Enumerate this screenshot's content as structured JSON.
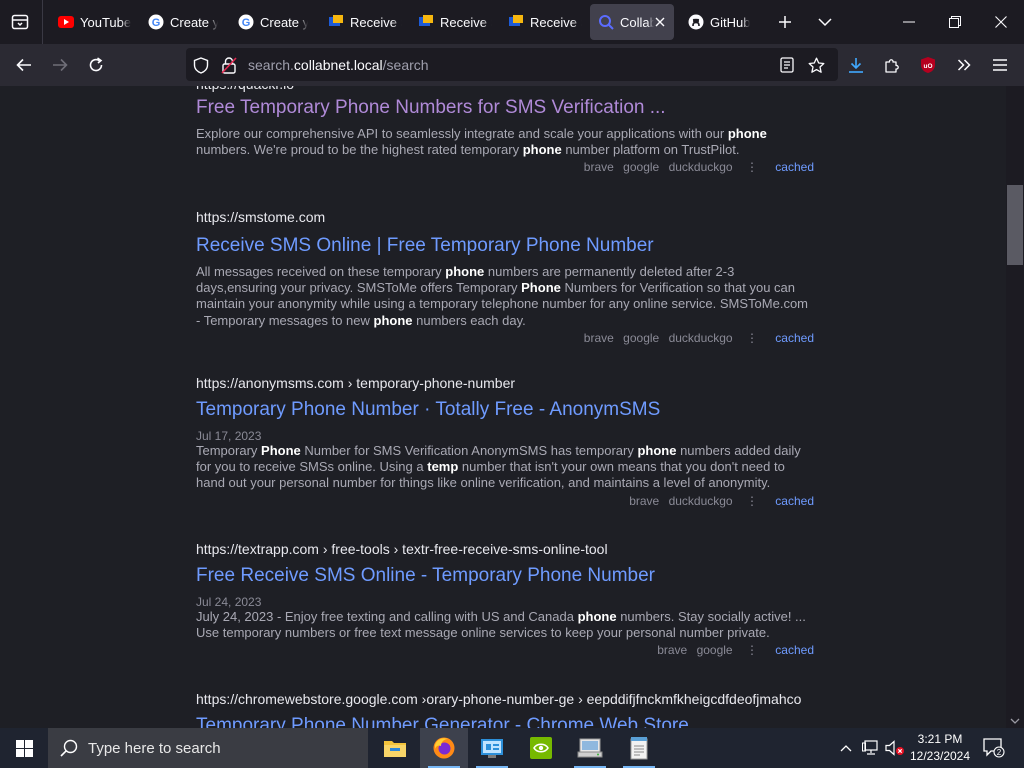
{
  "browser": {
    "tabs": [
      {
        "title": "YouTube",
        "favicon": "youtube-icon"
      },
      {
        "title": "Create yo",
        "favicon": "google-icon"
      },
      {
        "title": "Create yo",
        "favicon": "google-icon"
      },
      {
        "title": "Receive S",
        "favicon": "receive-sms-icon"
      },
      {
        "title": "Receive S",
        "favicon": "receive-sms-icon"
      },
      {
        "title": "Receive S",
        "favicon": "receive-sms-icon"
      },
      {
        "title": "Collab",
        "favicon": "collabnet-icon",
        "active": true
      },
      {
        "title": "GitHub",
        "favicon": "github-icon"
      }
    ],
    "url": {
      "prefix": "search.",
      "domain": "collabnet.local",
      "path": "/search"
    },
    "colors": {
      "link": "#6f9bff",
      "visited": "#b08ad8",
      "background": "#1e1f25",
      "accent_download": "#40a9ff"
    }
  },
  "results": [
    {
      "url": "https://quackr.io",
      "title": "Free Temporary Phone Numbers for SMS Verification ...",
      "visited": true,
      "date": "",
      "snippet_parts": [
        {
          "t": "Explore our comprehensive API to seamlessly integrate and scale your applications with our ",
          "b": false
        },
        {
          "t": "phone",
          "b": true
        },
        {
          "t": " numbers. We're proud to be the highest rated temporary ",
          "b": false
        },
        {
          "t": "phone",
          "b": true
        },
        {
          "t": " number platform on TrustPilot.",
          "b": false
        }
      ],
      "engines": [
        "brave",
        "google",
        "duckduckgo"
      ],
      "cached": "cached"
    },
    {
      "url": "https://smstome.com",
      "title": "Receive SMS Online | Free Temporary Phone Number",
      "visited": false,
      "date": "",
      "snippet_parts": [
        {
          "t": "All messages received on these temporary ",
          "b": false
        },
        {
          "t": "phone",
          "b": true
        },
        {
          "t": " numbers are permanently deleted after 2-3 days,ensuring your privacy. SMSToMe offers Temporary ",
          "b": false
        },
        {
          "t": "Phone",
          "b": true
        },
        {
          "t": " Numbers for Verification so that you can maintain your anonymity while using a temporary telephone number for any online service. SMSToMe.com - Temporary messages to new ",
          "b": false
        },
        {
          "t": "phone",
          "b": true
        },
        {
          "t": " numbers each day.",
          "b": false
        }
      ],
      "engines": [
        "brave",
        "google",
        "duckduckgo"
      ],
      "cached": "cached"
    },
    {
      "url": "https://anonymsms.com  › temporary-phone-number",
      "title": "Temporary Phone Number · Totally Free - AnonymSMS",
      "visited": false,
      "date": "Jul 17, 2023",
      "snippet_parts": [
        {
          "t": "Temporary ",
          "b": false
        },
        {
          "t": "Phone",
          "b": true
        },
        {
          "t": " Number for SMS Verification AnonymSMS has temporary ",
          "b": false
        },
        {
          "t": "phone",
          "b": true
        },
        {
          "t": " numbers added daily for you to receive SMSs online. Using a ",
          "b": false
        },
        {
          "t": "temp",
          "b": true
        },
        {
          "t": " number that isn't your own means that you don't need to hand out your personal number for things like online verification, and maintains a level of anonymity.",
          "b": false
        }
      ],
      "engines": [
        "brave",
        "duckduckgo"
      ],
      "cached": "cached"
    },
    {
      "url": "https://textrapp.com  › free-tools › textr-free-receive-sms-online-tool",
      "title": "Free Receive SMS Online - Temporary Phone Number",
      "visited": false,
      "date": "Jul 24, 2023",
      "snippet_parts": [
        {
          "t": "July 24, 2023 - Enjoy free texting and calling with US and Canada ",
          "b": false
        },
        {
          "t": "phone",
          "b": true
        },
        {
          "t": " numbers. Stay socially active! ... Use temporary numbers or free text message online services to keep your personal number private.",
          "b": false
        }
      ],
      "engines": [
        "brave",
        "google"
      ],
      "cached": "cached"
    },
    {
      "url": "https://chromewebstore.google.com  ›orary-phone-number-ge › eepddifjfnckmfkheigcdfdeofjmahco",
      "title": "Temporary Phone Number Generator - Chrome Web Store",
      "visited": false,
      "date": "",
      "snippet_parts": [],
      "engines": [],
      "cached": ""
    }
  ],
  "taskbar": {
    "search_placeholder": "Type here to search",
    "time": "3:21 PM",
    "date": "12/23/2024",
    "notification_count": "2",
    "apps": [
      "file-explorer-icon",
      "firefox-icon",
      "control-panel-icon",
      "nvidia-icon",
      "network-drive-icon",
      "notepad-icon"
    ]
  }
}
